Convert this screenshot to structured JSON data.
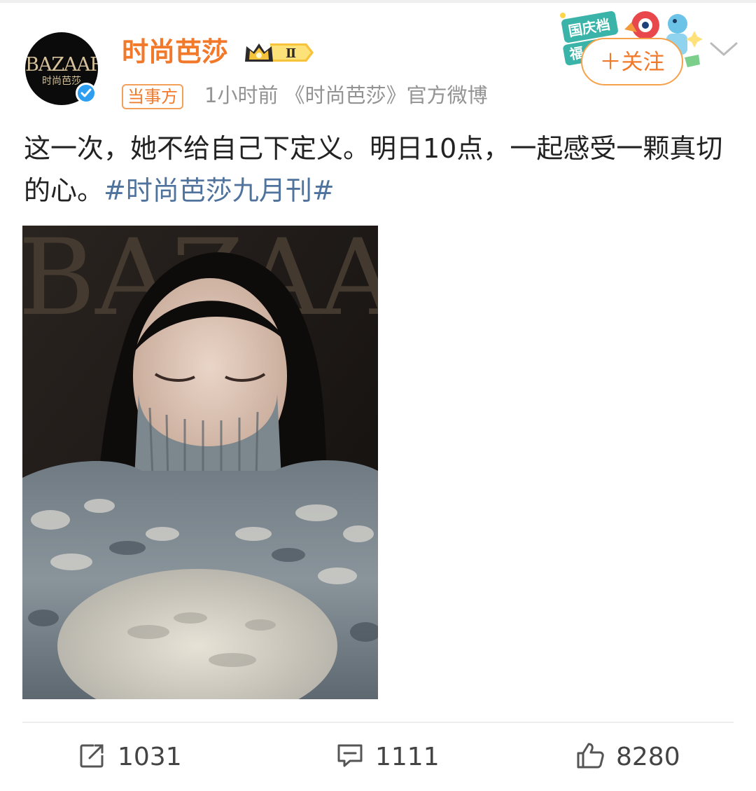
{
  "account": {
    "name": "时尚芭莎",
    "avatar_logo": "BAZAAR",
    "avatar_sub": "时尚芭莎",
    "badge_level": "Ⅱ",
    "tag": "当事方",
    "meta": "1小时前 《时尚芭莎》官方微博",
    "verified": true,
    "icons": [
      "verified-icon",
      "crown-badge-icon"
    ]
  },
  "header": {
    "follow_label": "＋关注",
    "promo_text_1": "国庆档",
    "promo_text_2": "福",
    "more_icon": "chevron-down-icon"
  },
  "post": {
    "text_part1": "这一次，她不给自己下定义。明日10点，一起感受一颗真切的心。",
    "hashtag": "#时尚芭莎九月刊#",
    "image": {
      "masthead": "BAZAAR"
    }
  },
  "actions": {
    "repost_count": "1031",
    "comment_count": "1111",
    "like_count": "8280"
  },
  "colors": {
    "username": "#f2782a",
    "hashtag": "#50739e",
    "meta": "#939393",
    "follow_border": "#f6a24a",
    "verified": "#2d9ef0"
  }
}
